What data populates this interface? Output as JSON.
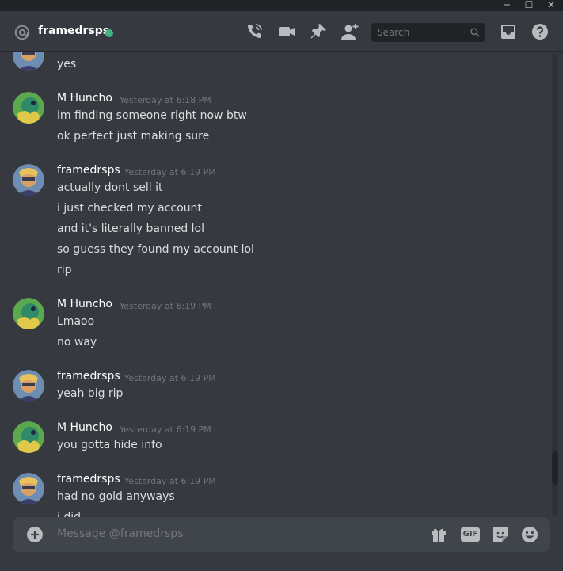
{
  "window_controls": {
    "minimize": "─",
    "maximize": "☐",
    "close": "✕"
  },
  "header": {
    "channel_name": "framedrsps",
    "status": "online",
    "icons": [
      "at-icon",
      "call-icon",
      "video-icon",
      "pin-icon",
      "add-friend-icon",
      "inbox-icon",
      "help-icon"
    ],
    "search_placeholder": "Search"
  },
  "messages": [
    {
      "user": "",
      "time": "",
      "lines": [
        "yes"
      ]
    },
    {
      "user": "M Huncho",
      "time": "Yesterday at 6:18 PM",
      "lines": [
        "im finding someone right now btw",
        "ok perfect just making sure"
      ]
    },
    {
      "user": "framedrsps",
      "time": "Yesterday at 6:19 PM",
      "lines": [
        "actually dont sell it",
        "i just checked my account",
        "and it's literally banned lol",
        "so guess they found my account lol",
        "rip"
      ]
    },
    {
      "user": "M Huncho",
      "time": "Yesterday at 6:19 PM",
      "lines": [
        "Lmaoo",
        "no way"
      ]
    },
    {
      "user": "framedrsps",
      "time": "Yesterday at 6:19 PM",
      "lines": [
        "yeah big rip"
      ]
    },
    {
      "user": "M Huncho",
      "time": "Yesterday at 6:19 PM",
      "lines": [
        "you gotta hide info"
      ]
    },
    {
      "user": "framedrsps",
      "time": "Yesterday at 6:19 PM",
      "lines": [
        "had no gold anyways",
        "i did"
      ]
    }
  ],
  "composer": {
    "placeholder": "Message @framedrsps",
    "gif_label": "GIF",
    "icons": [
      "add-attachment-icon",
      "gift-icon",
      "gif-icon",
      "sticker-icon",
      "emoji-icon"
    ]
  },
  "colors": {
    "background": "#36393f",
    "online": "#43b581",
    "composer": "#40444b"
  }
}
